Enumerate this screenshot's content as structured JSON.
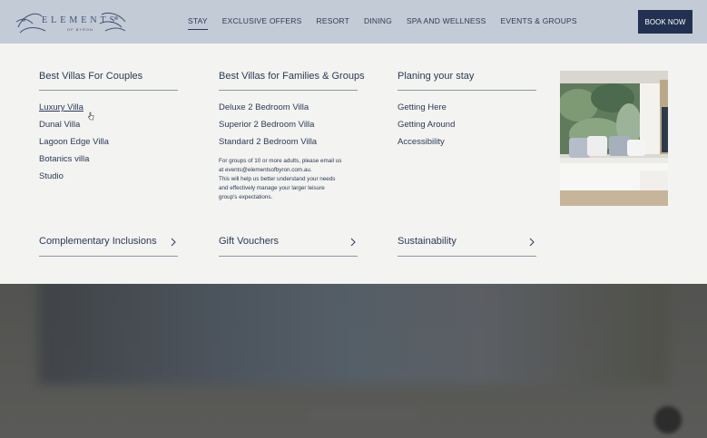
{
  "header": {
    "logo_text": "ELEMENTS",
    "logo_sub": "OF BYRON",
    "nav": [
      "STAY",
      "EXCLUSIVE OFFERS",
      "RESORT",
      "DINING",
      "SPA AND WELLNESS",
      "EVENTS & GROUPS"
    ],
    "active_nav": "STAY",
    "book_label": "BOOK NOW"
  },
  "menu": {
    "couples": {
      "title": "Best Villas For Couples",
      "links": [
        "Luxury Villa",
        "Dunal Villa",
        "Lagoon Edge Villa",
        "Botanics villa",
        "Studio"
      ]
    },
    "families": {
      "title": "Best Villas for Families & Groups",
      "links": [
        "Deluxe 2 Bedroom Villa",
        "Superior 2 Bedroom Villa",
        "Standard 2 Bedroom Villa"
      ],
      "note_lines": [
        "For groups of 10 or more adults, please email us",
        "at events@elementsofbyron.com.au.",
        "This will help us better understand your needs",
        "and effectively manage your larger leisure",
        "group's expectations."
      ]
    },
    "planning": {
      "title": "Planing your stay",
      "links": [
        "Getting Here",
        "Getting Around",
        "Accessibility"
      ]
    },
    "bottom": [
      "Complementary Inclusions",
      "Gift Vouchers",
      "Sustainability"
    ]
  },
  "icons": {
    "chevron": "chevron-right-icon",
    "cursor": "hand-pointer-icon"
  },
  "colors": {
    "header_bg": "#c3cbd6",
    "panel_bg": "#f3f3f1",
    "brand_navy": "#223150",
    "text": "#2b3a55"
  }
}
